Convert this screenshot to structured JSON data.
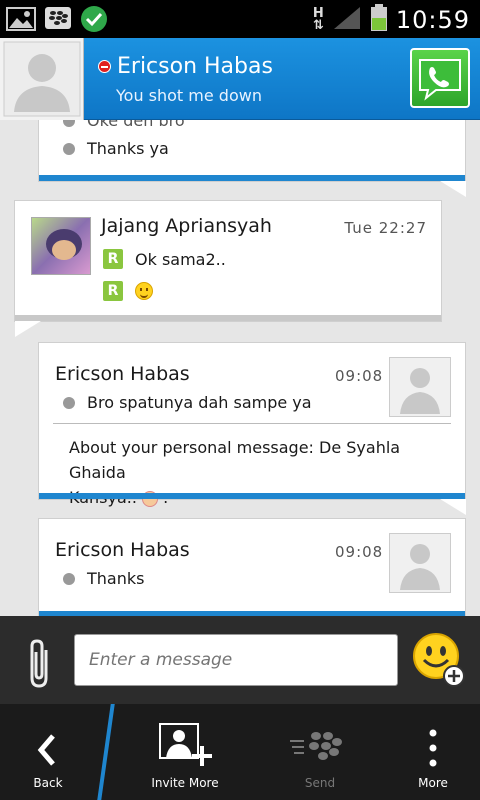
{
  "status_bar": {
    "time": "10:59",
    "network": "H",
    "icons": [
      "gallery-icon",
      "bbm-icon",
      "check-icon",
      "signal-icon",
      "battery-icon"
    ]
  },
  "header": {
    "contact_name": "Ericson Habas",
    "status_message": "You shot me down",
    "accent": "#1a8adb"
  },
  "messages": [
    {
      "lines": [
        "Oke deh bro",
        "Thanks ya"
      ]
    },
    {
      "sender": "Jajang Apriansyah",
      "time": "Tue 22:27",
      "lines": [
        "Ok sama2..",
        ""
      ]
    },
    {
      "sender": "Ericson Habas",
      "time": "09:08",
      "lines": [
        "Bro spatunya dah sampe ya"
      ],
      "personal_message_1": "About your personal message: De Syahla Ghaida",
      "personal_message_2": "Kansya.. ",
      "personal_message_3": "."
    },
    {
      "sender": "Ericson Habas",
      "time": "09:08",
      "lines": [
        "Thanks"
      ]
    }
  ],
  "composer": {
    "placeholder": "Enter a message"
  },
  "bottom_bar": {
    "back": "Back",
    "invite": "Invite More",
    "send": "Send",
    "more": "More"
  }
}
